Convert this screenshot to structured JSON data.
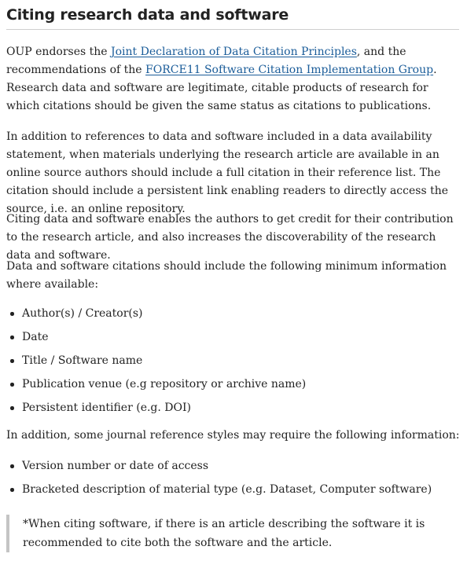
{
  "heading": "Citing research data and software",
  "intro": {
    "prefix": "OUP endorses the ",
    "link1": "Joint Declaration of Data Citation Principles",
    "middle": ", and the recommendations of the ",
    "link2": "FORCE11 Software Citation Implementation Group",
    "suffix": ".  Research data and software are legitimate, citable products of research for which citations should be given the same status as citations to publications."
  },
  "paragraphs": [
    "In addition to references to data and software included in a data availability statement, when materials underlying the research article are available in an online source authors should include a full citation in their reference list. The citation should include a persistent link enabling readers to directly access the source, i.e. an online repository.",
    "Citing data and software enables the authors to get credit for their contribution to the research article, and also increases the discoverability of the research data and software.",
    "Data and software citations should include the following minimum information where available:"
  ],
  "minimum_items": [
    "Author(s) / Creator(s)",
    "Date",
    "Title / Software name",
    "Publication venue (e.g repository or archive name)",
    "Persistent identifier (e.g. DOI)"
  ],
  "additional_intro": "In addition, some journal reference styles may require the following information:",
  "additional_items": [
    "Version number or date of access",
    "Bracketed description of material type (e.g. Dataset, Computer software)"
  ],
  "note": "*When citing software, if there is an article describing the software it is recommended to cite both the software and the article.",
  "colors": {
    "text": "#222222",
    "link": "#1a5c99",
    "rule": "#cfcfcf",
    "blockquote_bar": "#c4c4c4"
  }
}
